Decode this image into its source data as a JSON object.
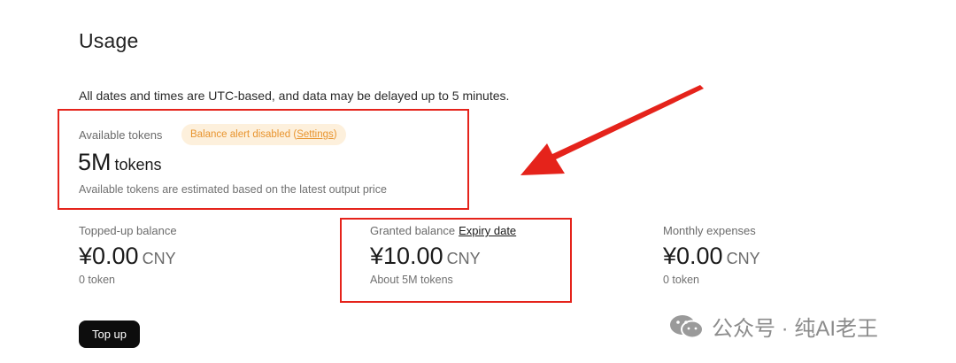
{
  "page": {
    "title": "Usage",
    "notice": "All dates and times are UTC-based, and data may be delayed up to 5 minutes."
  },
  "available": {
    "label": "Available tokens",
    "alert_text": "Balance alert disabled (",
    "alert_link": "Settings",
    "alert_close": ")",
    "value": "5M",
    "unit": "tokens",
    "note": "Available tokens are estimated based on the latest output price"
  },
  "cards": {
    "topped_up": {
      "label": "Topped-up balance",
      "amount": "¥0.00",
      "currency": "CNY",
      "sub": "0 token"
    },
    "granted": {
      "label": "Granted balance",
      "link": "Expiry date",
      "amount": "¥10.00",
      "currency": "CNY",
      "sub": "About 5M tokens"
    },
    "monthly": {
      "label": "Monthly expenses",
      "amount": "¥0.00",
      "currency": "CNY",
      "sub": "0 token"
    }
  },
  "actions": {
    "topup_label": "Top up"
  },
  "watermark": {
    "text": "公众号 · 纯AI老王",
    "icon": "wechat-icon"
  },
  "colors": {
    "annotation_red": "#e5231b",
    "alert_orange": "#e8942e",
    "alert_bg": "#fdf0dc",
    "button_bg": "#0d0d0d"
  }
}
